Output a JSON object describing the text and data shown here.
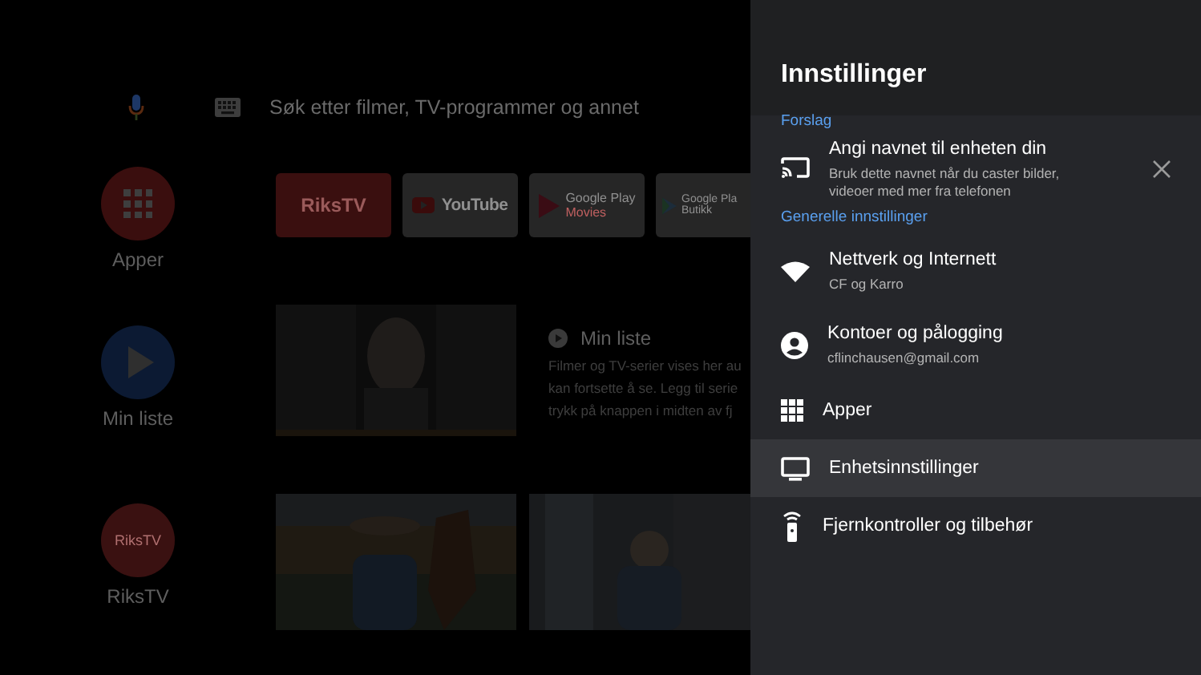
{
  "search": {
    "placeholder": "Søk etter filmer, TV-programmer og annet"
  },
  "channels": [
    {
      "kind": "apps",
      "label": "Apper"
    },
    {
      "kind": "list",
      "label": "Min liste"
    },
    {
      "kind": "app",
      "label": "RiksTV",
      "logo": "RiksTV"
    }
  ],
  "app_tiles": [
    {
      "kind": "riks",
      "title": "RiksTV"
    },
    {
      "kind": "youtube",
      "title": "YouTube"
    },
    {
      "kind": "movies",
      "title": "Google Play",
      "subtitle": "Movies"
    },
    {
      "kind": "store",
      "title": "Google Pla",
      "subtitle": "Butikk"
    }
  ],
  "my_list": {
    "title": "Min liste",
    "lines": [
      "Filmer og TV-serier vises her au",
      "kan fortsette å se. Legg til serie",
      "trykk på knappen i midten av fj"
    ]
  },
  "panel": {
    "title": "Innstillinger",
    "sections": [
      {
        "heading": "Forslag",
        "items": [
          {
            "kind": "cast",
            "title": "Angi navnet til enheten din",
            "subtitle": "Bruk dette navnet når du caster bilder, videoer med mer fra telefonen",
            "dismissible": true,
            "selected": false
          }
        ]
      },
      {
        "heading": "Generelle innstillinger",
        "items": [
          {
            "kind": "wifi",
            "title": "Nettverk og Internett",
            "subtitle": "CF og Karro",
            "dismissible": false,
            "selected": false
          },
          {
            "kind": "account",
            "title": "Kontoer og pålogging",
            "subtitle": "cflinchausen@gmail.com",
            "dismissible": false,
            "selected": false
          },
          {
            "kind": "apps",
            "title": "Apper",
            "dismissible": false,
            "selected": false
          },
          {
            "kind": "tv",
            "title": "Enhetsinnstillinger",
            "dismissible": false,
            "selected": true
          },
          {
            "kind": "remote",
            "title": "Fjernkontroller og tilbehør",
            "dismissible": false,
            "selected": false
          }
        ]
      }
    ]
  }
}
